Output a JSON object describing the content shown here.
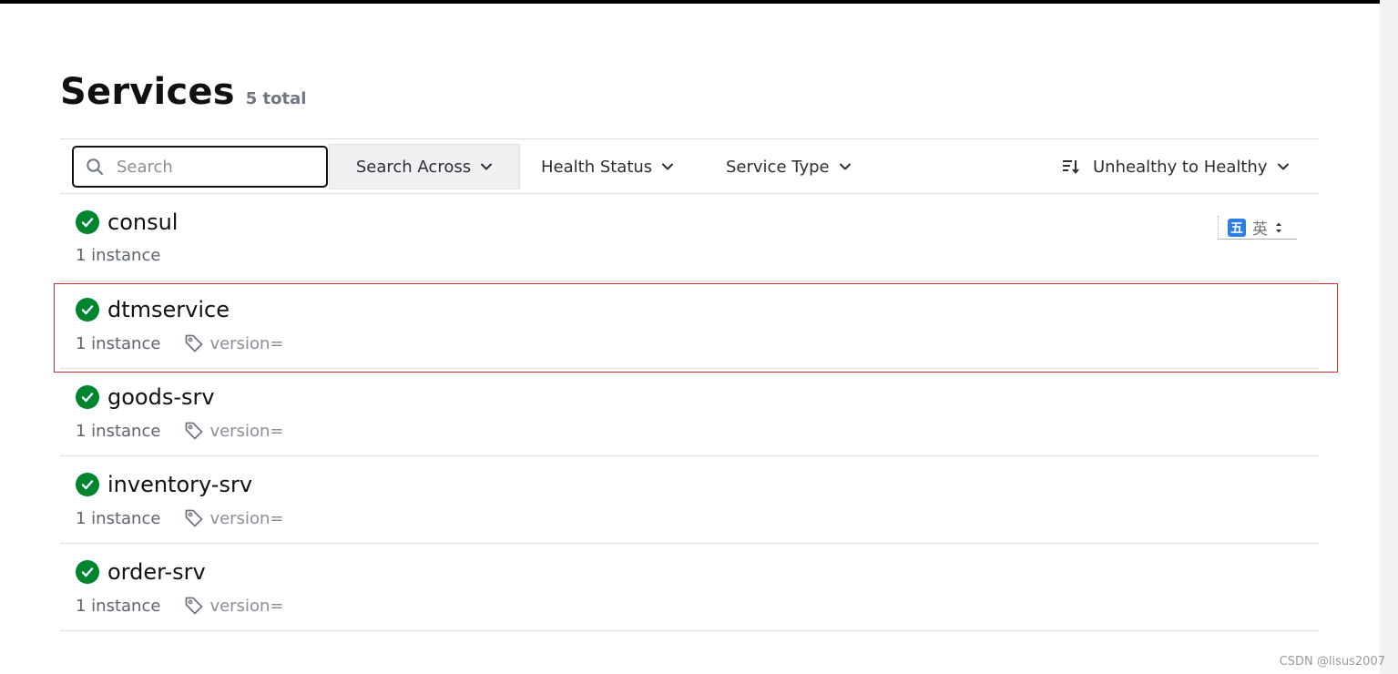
{
  "page": {
    "title": "Services",
    "count": "5 total"
  },
  "toolbar": {
    "search_placeholder": "Search",
    "search_across_label": "Search Across",
    "health_status_label": "Health Status",
    "service_type_label": "Service Type",
    "sort_label": "Unhealthy to Healthy"
  },
  "services": [
    {
      "name": "consul",
      "instances": "1 instance",
      "tag": "",
      "health": "passing"
    },
    {
      "name": "dtmservice",
      "instances": "1 instance",
      "tag": "version=",
      "health": "passing"
    },
    {
      "name": "goods-srv",
      "instances": "1 instance",
      "tag": "version=",
      "health": "passing"
    },
    {
      "name": "inventory-srv",
      "instances": "1 instance",
      "tag": "version=",
      "health": "passing"
    },
    {
      "name": "order-srv",
      "instances": "1 instance",
      "tag": "version=",
      "health": "passing"
    }
  ],
  "ime": {
    "mode_label": "五",
    "lang_label": "英"
  },
  "watermark": "CSDN @lisus2007",
  "colors": {
    "health_passing": "#00852f",
    "highlight_border": "#d42b2b",
    "ime_blue": "#2f7ee8"
  },
  "icons": {
    "search": "search-icon",
    "chevron": "chevron-down-icon",
    "sort": "sort-icon",
    "health": "check-circle-icon",
    "tag": "tag-icon"
  }
}
